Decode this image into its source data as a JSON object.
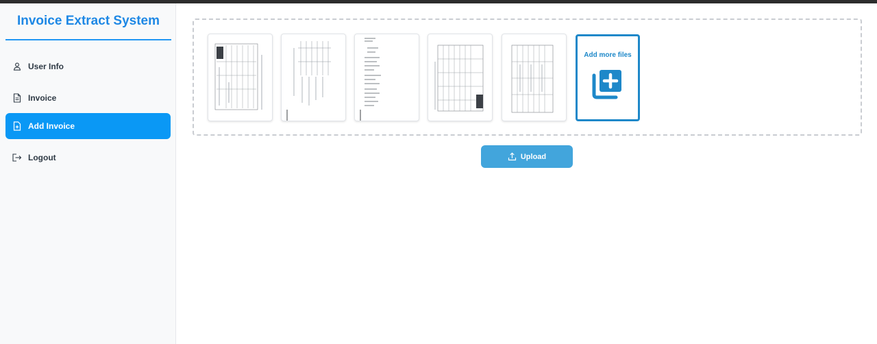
{
  "app": {
    "title": "Invoice Extract System"
  },
  "sidebar": {
    "items": [
      {
        "label": "User Info",
        "icon": "user-icon",
        "active": false
      },
      {
        "label": "Invoice",
        "icon": "document-icon",
        "active": false
      },
      {
        "label": "Add Invoice",
        "icon": "file-plus-icon",
        "active": true
      },
      {
        "label": "Logout",
        "icon": "logout-icon",
        "active": false
      }
    ]
  },
  "upload": {
    "thumbnails": [
      {
        "icon": "invoice-page-thumbnail"
      },
      {
        "icon": "invoice-page-thumbnail"
      },
      {
        "icon": "invoice-page-thumbnail"
      },
      {
        "icon": "invoice-page-thumbnail"
      },
      {
        "icon": "invoice-page-thumbnail"
      }
    ],
    "add_more_label": "Add more files",
    "button_label": "Upload"
  },
  "colors": {
    "brand": "#1e88e5",
    "active_nav": "#0a98f5",
    "upload_button": "#42a5dc",
    "add_more_border": "#1e88c9"
  }
}
